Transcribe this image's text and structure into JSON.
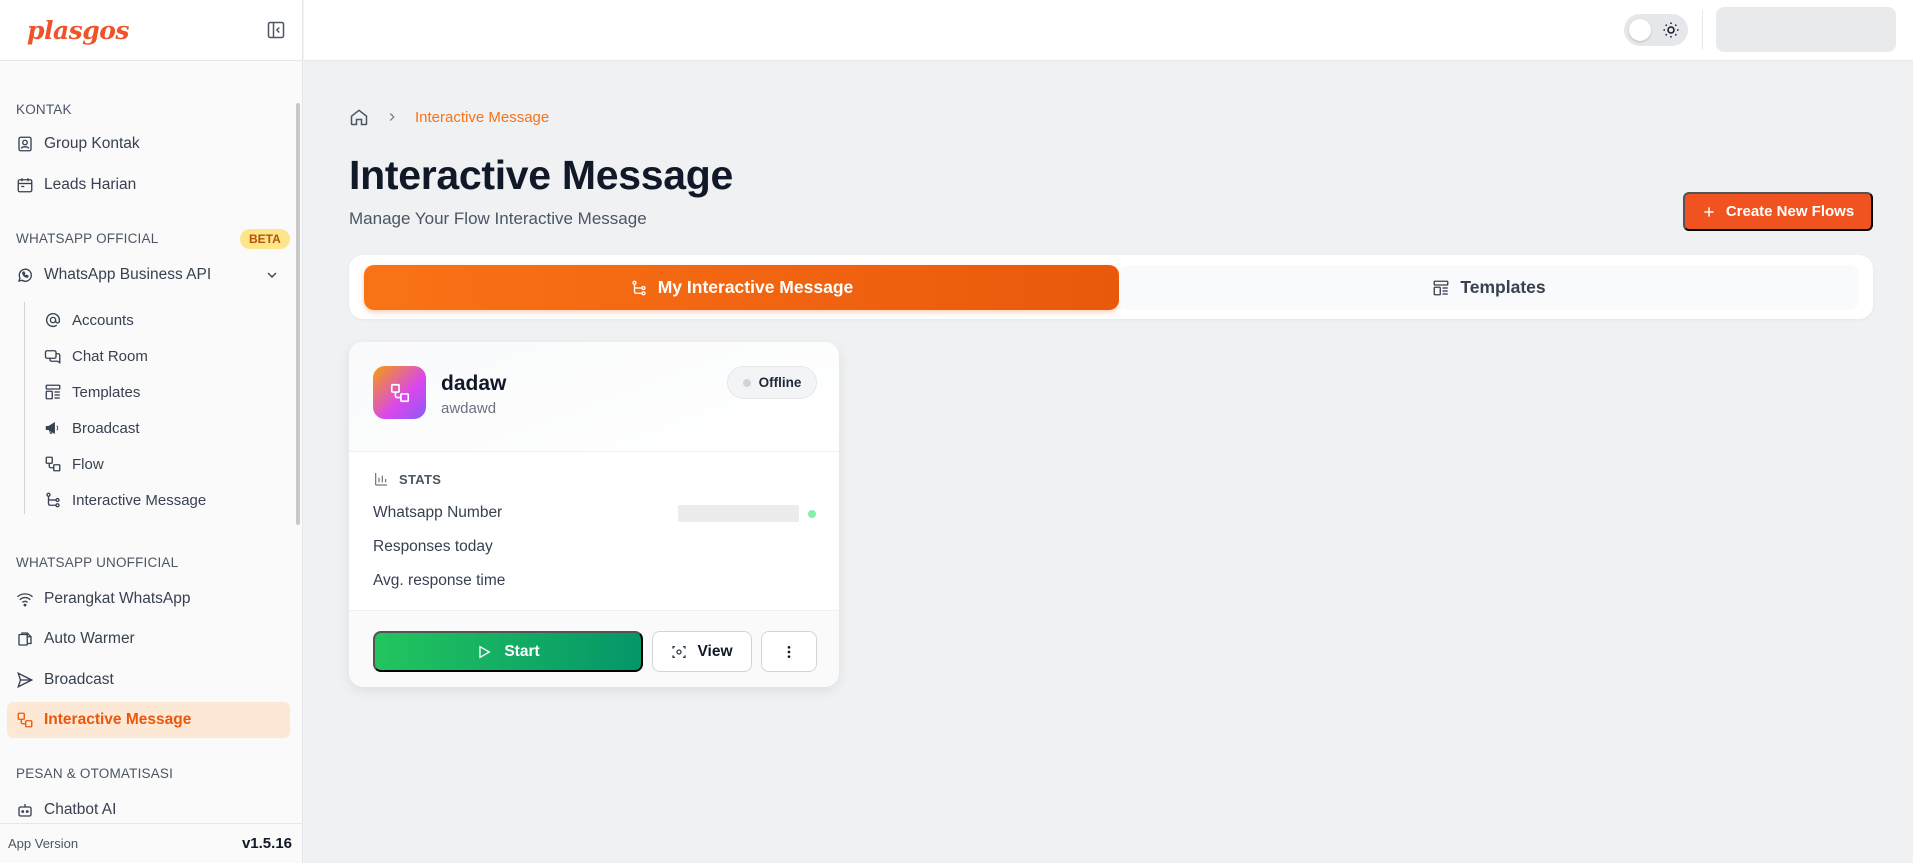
{
  "brand": {
    "name": "plasgos"
  },
  "sidebar": {
    "sections": [
      {
        "title": "KONTAK"
      },
      {
        "title": "WHATSAPP OFFICIAL",
        "badge": "BETA"
      },
      {
        "title": "WHATSAPP UNOFFICIAL"
      },
      {
        "title": "PESAN & OTOMATISASI"
      }
    ],
    "kontak_items": [
      {
        "label": "Group Kontak",
        "icon": "contact-book-icon"
      },
      {
        "label": "Leads Harian",
        "icon": "calendar-icon"
      }
    ],
    "official_parent": {
      "label": "WhatsApp Business API",
      "icon": "whatsapp-icon"
    },
    "official_items": [
      {
        "label": "Accounts",
        "icon": "at-sign-icon"
      },
      {
        "label": "Chat Room",
        "icon": "chat-icon"
      },
      {
        "label": "Templates",
        "icon": "templates-icon"
      },
      {
        "label": "Broadcast",
        "icon": "megaphone-icon"
      },
      {
        "label": "Flow",
        "icon": "flow-icon"
      },
      {
        "label": "Interactive Message",
        "icon": "branch-icon"
      }
    ],
    "unofficial_items": [
      {
        "label": "Perangkat WhatsApp",
        "icon": "wifi-icon"
      },
      {
        "label": "Auto Warmer",
        "icon": "auto-warmer-icon"
      },
      {
        "label": "Broadcast",
        "icon": "send-icon"
      },
      {
        "label": "Interactive Message",
        "icon": "flow-icon",
        "active": true
      }
    ],
    "pesan_items": [
      {
        "label": "Chatbot AI",
        "icon": "bot-icon"
      }
    ],
    "footer": {
      "label": "App Version",
      "version": "v1.5.16"
    }
  },
  "breadcrumb": {
    "current": "Interactive Message"
  },
  "page": {
    "title": "Interactive Message",
    "subtitle": "Manage Your Flow Interactive Message",
    "create_button": "Create New Flows"
  },
  "tabs": [
    {
      "label": "My Interactive Message",
      "active": true,
      "icon": "branch-icon"
    },
    {
      "label": "Templates",
      "active": false,
      "icon": "templates-icon"
    }
  ],
  "card": {
    "name": "dadaw",
    "description": "awdawd",
    "status": "Offline",
    "stats_title": "STATS",
    "stats": [
      {
        "label": "Whatsapp Number"
      },
      {
        "label": "Responses today"
      },
      {
        "label": "Avg. response time"
      }
    ],
    "start_label": "Start",
    "view_label": "View"
  },
  "colors": {
    "accent": "#f97316",
    "brand": "#f0532a",
    "success": "#22c55e"
  }
}
